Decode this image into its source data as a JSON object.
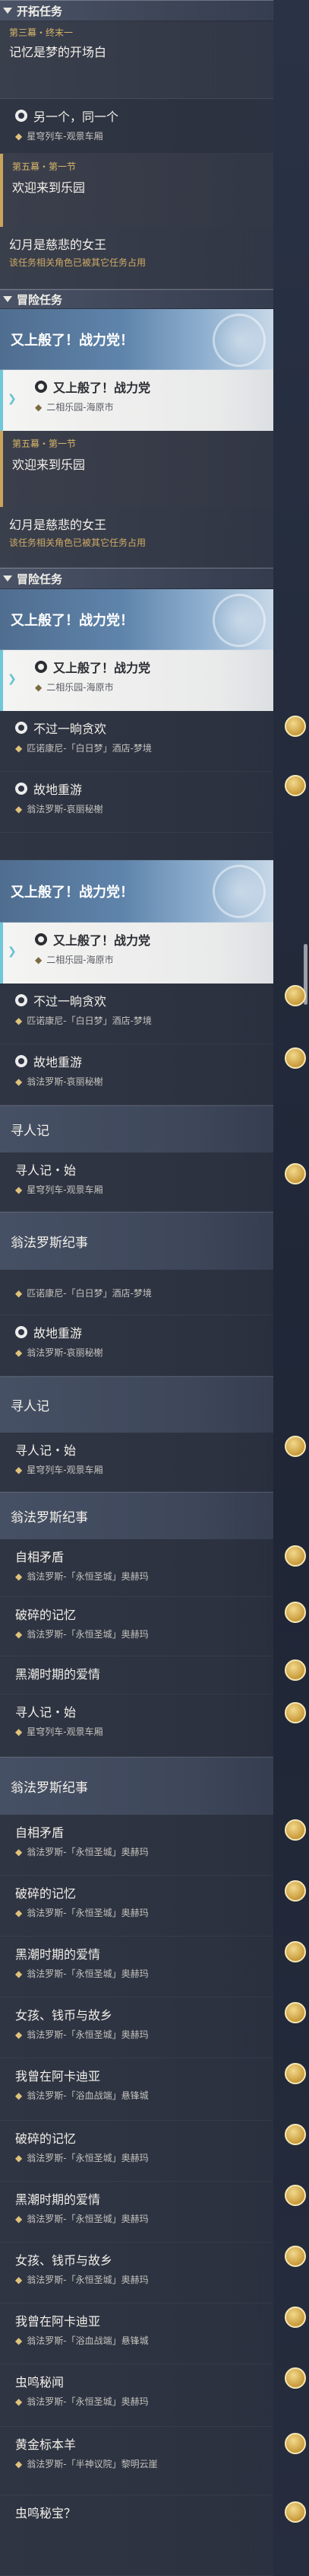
{
  "colors": {
    "gold_text": "#d8b56a",
    "banner_blue": "#5f84ab",
    "selected_bg": "#f4f4f2",
    "accent_cyan": "#6fc7d9"
  },
  "icons": [
    "pin-icon",
    "quest-icon",
    "reward-badge-icon",
    "emblem-icon",
    "caret-icon"
  ],
  "sec": {
    "trailblaze": "开拓任务",
    "adventure": "冒险任务"
  },
  "q": {
    "ch3": "第三幕・终末一",
    "ch3_title": "记忆是梦的开场白",
    "another_one": "另一个，同一个",
    "observe_loc": "星穹列车-观景车厢",
    "ch5": "第五幕・第一节",
    "ch5_title": "欢迎来到乐园",
    "queen": "幻月是慈悲的女王",
    "queen_sub": "该任务相关角色已被其它任务占用",
    "again": "又上般了！战力党！",
    "again_item": "又上般了！战力党",
    "again_loc": "二相乐园-海原市",
    "not_fun": "不过一晌贪欢",
    "not_fun_loc": "匹诺康尼-「白日梦」酒店-梦境",
    "revisit": "故地重游",
    "revisit_loc": "翁法罗斯-哀丽秘榭",
    "seek": "寻人记",
    "seek_start": "寻人记・始",
    "chronicle": "翁法罗斯纪事",
    "self": "自相矛盾",
    "okhema": "翁法罗斯-「永恒圣城」奥赫玛",
    "broken": "破碎的记忆",
    "tide": "黑潮时期的爱情",
    "girl": "女孩、钱币与故乡",
    "aedes": "我曾在阿卡迪亚",
    "aedes_loc": "翁法罗斯-「浴血战端」悬锋城",
    "bug_secret": "虫鸣秘闻",
    "golden": "黄金标本羊",
    "golden_loc": "翁法罗斯-「半神议院」黎明云崖",
    "bug_q": "虫鸣秘宝？"
  }
}
